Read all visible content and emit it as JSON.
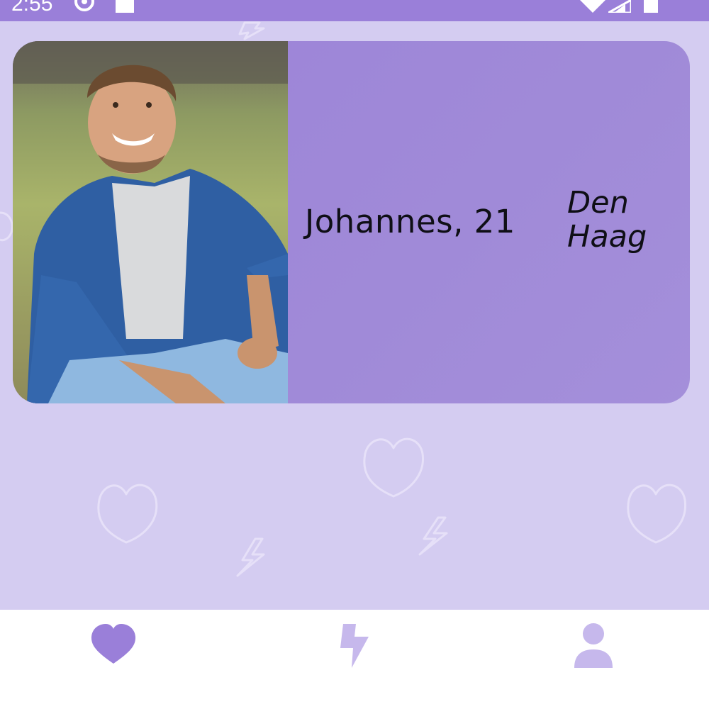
{
  "status_bar": {
    "time": "2:55",
    "icons": [
      "settings-icon",
      "sim-card-icon",
      "wifi-icon",
      "signal-icon",
      "battery-icon"
    ]
  },
  "card": {
    "name_age": "Johannes, 21",
    "city": "Den Haag",
    "photo": "profile-photo"
  },
  "bottom_nav": {
    "items": [
      {
        "icon": "heart-icon",
        "active": true
      },
      {
        "icon": "bolt-icon",
        "active": false
      },
      {
        "icon": "person-icon",
        "active": false
      }
    ]
  },
  "colors": {
    "accent": "#9a7fd9",
    "background": "#d4ccf1",
    "card": "#9c83d9",
    "nav_inactive": "#c6b8ec",
    "nav_active": "#9a7fd9"
  }
}
